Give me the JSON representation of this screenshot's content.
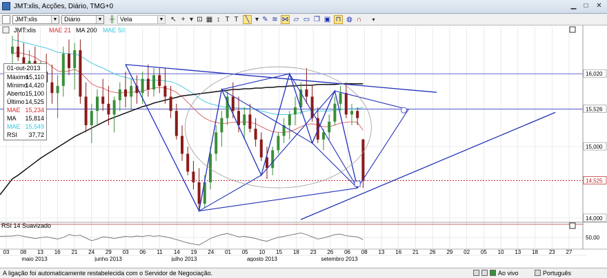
{
  "window": {
    "title": "JMT:xlis, Acções, Diário, TMG+0",
    "minimize_glyph": "▁",
    "maximize_glyph": "□",
    "close_glyph": "✕"
  },
  "toolbar": {
    "symbol": "JMT:xlis",
    "period": "Diário",
    "chart_type": "Vela"
  },
  "legend": {
    "symbol": "JMT:xlis",
    "mae": "MAE 21",
    "ma": "MA 200",
    "mae2": "MAE 50"
  },
  "info_box": {
    "date": "01-out-2013",
    "rows": [
      {
        "key": "Máximo",
        "value": "15,110",
        "color": "#000000"
      },
      {
        "key": "Mínimo",
        "value": "14,420",
        "color": "#000000"
      },
      {
        "key": "Aberto",
        "value": "15,100",
        "color": "#000000"
      },
      {
        "key": "Último",
        "value": "14,525",
        "color": "#000000"
      },
      {
        "key": "MAE",
        "value": "15,234",
        "color": "#d42a2a"
      },
      {
        "key": "MA",
        "value": "15,814",
        "color": "#000000"
      },
      {
        "key": "MAE",
        "value": "15,549",
        "color": "#33c7e0"
      },
      {
        "key": "RSI",
        "value": "37,72",
        "color": "#000000"
      }
    ]
  },
  "rsi_pane": {
    "label": "RSI 14 Suavizado",
    "level_label": "50,00"
  },
  "price_labels": [
    "16,020",
    "15,526",
    "15,000",
    "14,525",
    "14,000"
  ],
  "day_labels": [
    "03",
    "08",
    "13",
    "16",
    "21",
    "24",
    "29",
    "03",
    "06",
    "11",
    "14",
    "19",
    "24",
    "01",
    "05",
    "10",
    "15",
    "18",
    "23",
    "26",
    "06",
    "08",
    "13",
    "16",
    "21",
    "26",
    "29",
    "02",
    "05",
    "10",
    "13",
    "18",
    "23",
    "27"
  ],
  "month_labels": [
    "maio 2013",
    "junho 2013",
    "julho 2013",
    "agosto 2013",
    "setembro 2013"
  ],
  "status": {
    "message": "A ligação foi automaticamente restabelecida com o Servidor de Negociação.",
    "mode": "Ao vivo",
    "language": "Português"
  },
  "colors": {
    "up_candle": "#3a8f3a",
    "down_candle": "#8b1a1a",
    "drawing": "#2231b8",
    "mae21": "#d95c5c",
    "mae50": "#35c4dc",
    "ma200": "#111111",
    "last_price": "#c02020"
  },
  "chart_data": {
    "type": "candlestick",
    "series": [
      {
        "name": "MAE 21"
      },
      {
        "name": "MA 200"
      },
      {
        "name": "MAE 50"
      },
      {
        "name": "RSI 14 Suavizado"
      }
    ],
    "y_ticks": [
      16.02,
      15.526,
      15.0,
      14.525,
      14.0
    ],
    "last": 14.525,
    "y_range": [
      13.98,
      16.6
    ],
    "bars": [
      {
        "o": 16.3,
        "h": 16.55,
        "l": 16.1,
        "c": 16.4
      },
      {
        "o": 16.4,
        "h": 16.6,
        "l": 16.2,
        "c": 16.25
      },
      {
        "o": 16.25,
        "h": 16.45,
        "l": 15.95,
        "c": 16.1
      },
      {
        "o": 16.1,
        "h": 16.35,
        "l": 15.9,
        "c": 16.2
      },
      {
        "o": 16.2,
        "h": 16.4,
        "l": 15.85,
        "c": 15.95
      },
      {
        "o": 15.95,
        "h": 16.2,
        "l": 15.7,
        "c": 16.05
      },
      {
        "o": 16.05,
        "h": 16.3,
        "l": 15.8,
        "c": 15.9
      },
      {
        "o": 15.9,
        "h": 16.15,
        "l": 15.6,
        "c": 15.75
      },
      {
        "o": 15.75,
        "h": 16.0,
        "l": 15.4,
        "c": 15.85
      },
      {
        "o": 15.85,
        "h": 16.4,
        "l": 15.7,
        "c": 16.3
      },
      {
        "o": 16.3,
        "h": 16.5,
        "l": 16.0,
        "c": 16.1
      },
      {
        "o": 16.1,
        "h": 16.45,
        "l": 15.8,
        "c": 16.35
      },
      {
        "o": 16.35,
        "h": 16.5,
        "l": 15.6,
        "c": 15.7
      },
      {
        "o": 15.7,
        "h": 15.9,
        "l": 15.2,
        "c": 15.3
      },
      {
        "o": 15.3,
        "h": 15.6,
        "l": 15.05,
        "c": 15.5
      },
      {
        "o": 15.5,
        "h": 15.8,
        "l": 15.3,
        "c": 15.7
      },
      {
        "o": 15.7,
        "h": 15.95,
        "l": 15.5,
        "c": 15.6
      },
      {
        "o": 15.6,
        "h": 15.85,
        "l": 15.3,
        "c": 15.45
      },
      {
        "o": 15.45,
        "h": 15.7,
        "l": 15.2,
        "c": 15.65
      },
      {
        "o": 15.65,
        "h": 15.9,
        "l": 15.5,
        "c": 15.8
      },
      {
        "o": 15.8,
        "h": 16.05,
        "l": 15.55,
        "c": 15.7
      },
      {
        "o": 15.7,
        "h": 15.95,
        "l": 15.5,
        "c": 15.85
      },
      {
        "o": 15.85,
        "h": 16.0,
        "l": 15.6,
        "c": 15.75
      },
      {
        "o": 15.75,
        "h": 16.05,
        "l": 15.6,
        "c": 15.95
      },
      {
        "o": 15.95,
        "h": 16.15,
        "l": 15.7,
        "c": 15.8
      },
      {
        "o": 15.8,
        "h": 16.1,
        "l": 15.7,
        "c": 16.0
      },
      {
        "o": 16.0,
        "h": 16.1,
        "l": 15.75,
        "c": 15.85
      },
      {
        "o": 15.85,
        "h": 16.1,
        "l": 15.6,
        "c": 15.7
      },
      {
        "o": 15.7,
        "h": 15.85,
        "l": 15.4,
        "c": 15.5
      },
      {
        "o": 15.5,
        "h": 15.6,
        "l": 15.1,
        "c": 15.15
      },
      {
        "o": 15.15,
        "h": 15.3,
        "l": 14.8,
        "c": 14.9
      },
      {
        "o": 14.9,
        "h": 15.0,
        "l": 14.6,
        "c": 14.65
      },
      {
        "o": 14.65,
        "h": 14.8,
        "l": 14.4,
        "c": 14.5
      },
      {
        "o": 14.5,
        "h": 14.7,
        "l": 14.1,
        "c": 14.2
      },
      {
        "o": 14.2,
        "h": 14.6,
        "l": 14.15,
        "c": 14.5
      },
      {
        "o": 14.5,
        "h": 15.0,
        "l": 14.4,
        "c": 14.9
      },
      {
        "o": 14.9,
        "h": 15.3,
        "l": 14.8,
        "c": 15.2
      },
      {
        "o": 15.2,
        "h": 15.5,
        "l": 15.0,
        "c": 15.4
      },
      {
        "o": 15.4,
        "h": 15.8,
        "l": 15.3,
        "c": 15.7
      },
      {
        "o": 15.7,
        "h": 15.9,
        "l": 15.4,
        "c": 15.5
      },
      {
        "o": 15.5,
        "h": 15.7,
        "l": 15.2,
        "c": 15.3
      },
      {
        "o": 15.3,
        "h": 15.55,
        "l": 15.1,
        "c": 15.45
      },
      {
        "o": 15.45,
        "h": 15.6,
        "l": 15.2,
        "c": 15.25
      },
      {
        "o": 15.25,
        "h": 15.4,
        "l": 15.0,
        "c": 15.1
      },
      {
        "o": 15.1,
        "h": 15.2,
        "l": 14.8,
        "c": 14.85
      },
      {
        "o": 14.85,
        "h": 15.0,
        "l": 14.55,
        "c": 14.7
      },
      {
        "o": 14.7,
        "h": 15.0,
        "l": 14.6,
        "c": 14.95
      },
      {
        "o": 14.95,
        "h": 15.2,
        "l": 14.9,
        "c": 15.15
      },
      {
        "o": 15.15,
        "h": 15.4,
        "l": 15.05,
        "c": 15.3
      },
      {
        "o": 15.3,
        "h": 15.5,
        "l": 15.1,
        "c": 15.45
      },
      {
        "o": 15.45,
        "h": 15.7,
        "l": 15.3,
        "c": 15.55
      },
      {
        "o": 15.55,
        "h": 15.9,
        "l": 15.45,
        "c": 15.8
      },
      {
        "o": 15.8,
        "h": 16.1,
        "l": 15.6,
        "c": 15.7
      },
      {
        "o": 15.7,
        "h": 15.85,
        "l": 15.35,
        "c": 15.4
      },
      {
        "o": 15.4,
        "h": 15.55,
        "l": 15.05,
        "c": 15.1
      },
      {
        "o": 15.1,
        "h": 15.25,
        "l": 14.95,
        "c": 15.2
      },
      {
        "o": 15.2,
        "h": 15.45,
        "l": 15.1,
        "c": 15.35
      },
      {
        "o": 15.35,
        "h": 15.7,
        "l": 15.3,
        "c": 15.6
      },
      {
        "o": 15.6,
        "h": 15.85,
        "l": 15.5,
        "c": 15.75
      },
      {
        "o": 15.75,
        "h": 15.9,
        "l": 15.4,
        "c": 15.45
      },
      {
        "o": 15.45,
        "h": 15.6,
        "l": 15.3,
        "c": 15.5
      },
      {
        "o": 15.5,
        "h": 15.55,
        "l": 15.3,
        "c": 15.4
      },
      {
        "o": 15.1,
        "h": 15.11,
        "l": 14.42,
        "c": 14.525
      }
    ],
    "ma200": [
      14.55,
      14.6,
      14.66,
      14.72,
      14.78,
      14.84,
      14.89,
      14.94,
      14.99,
      15.04,
      15.09,
      15.14,
      15.18,
      15.22,
      15.26,
      15.3,
      15.34,
      15.38,
      15.41,
      15.44,
      15.47,
      15.5,
      15.53,
      15.56,
      15.58,
      15.61,
      15.63,
      15.65,
      15.67,
      15.69,
      15.71,
      15.72,
      15.73,
      15.74,
      15.75,
      15.76,
      15.77,
      15.78,
      15.79,
      15.8,
      15.8,
      15.81,
      15.81,
      15.82,
      15.82,
      15.83,
      15.83,
      15.84,
      15.84,
      15.85,
      15.85,
      15.86,
      15.86,
      15.86,
      15.87,
      15.87,
      15.87,
      15.87,
      15.88,
      15.88,
      15.88,
      15.88,
      15.88
    ],
    "mae21": [
      16.3,
      16.32,
      16.3,
      16.28,
      16.25,
      16.2,
      16.18,
      16.12,
      16.06,
      16.05,
      16.06,
      16.08,
      16.04,
      15.96,
      15.88,
      15.84,
      15.82,
      15.78,
      15.76,
      15.75,
      15.76,
      15.76,
      15.77,
      15.78,
      15.8,
      15.82,
      15.83,
      15.82,
      15.8,
      15.76,
      15.7,
      15.62,
      15.54,
      15.46,
      15.4,
      15.36,
      15.34,
      15.32,
      15.33,
      15.34,
      15.34,
      15.35,
      15.34,
      15.32,
      15.28,
      15.24,
      15.21,
      15.2,
      15.2,
      15.21,
      15.24,
      15.28,
      15.31,
      15.32,
      15.3,
      15.28,
      15.28,
      15.3,
      15.33,
      15.34,
      15.35,
      15.34,
      15.23
    ],
    "mae50": [
      16.5,
      16.48,
      16.46,
      16.44,
      16.42,
      16.4,
      16.38,
      16.35,
      16.32,
      16.31,
      16.3,
      16.3,
      16.27,
      16.22,
      16.17,
      16.13,
      16.1,
      16.06,
      16.02,
      15.99,
      15.97,
      15.95,
      15.94,
      15.93,
      15.93,
      15.93,
      15.93,
      15.92,
      15.91,
      15.88,
      15.84,
      15.79,
      15.74,
      15.68,
      15.63,
      15.6,
      15.58,
      15.56,
      15.55,
      15.55,
      15.54,
      15.54,
      15.53,
      15.52,
      15.5,
      15.48,
      15.46,
      15.45,
      15.45,
      15.45,
      15.46,
      15.48,
      15.5,
      15.51,
      15.5,
      15.5,
      15.5,
      15.51,
      15.52,
      15.53,
      15.53,
      15.53,
      15.55
    ],
    "rsi": [
      55,
      58,
      54,
      50,
      46,
      49,
      52,
      48,
      44,
      50,
      60,
      56,
      58,
      48,
      38,
      44,
      52,
      50,
      46,
      50,
      54,
      52,
      55,
      53,
      57,
      54,
      56,
      52,
      48,
      42,
      36,
      30,
      26,
      22,
      34,
      46,
      54,
      60,
      64,
      58,
      52,
      54,
      50,
      46,
      40,
      36,
      44,
      50,
      54,
      58,
      62,
      66,
      60,
      52,
      44,
      48,
      54,
      60,
      62,
      56,
      54,
      52,
      42
    ],
    "rsi_range": [
      10,
      90
    ]
  }
}
